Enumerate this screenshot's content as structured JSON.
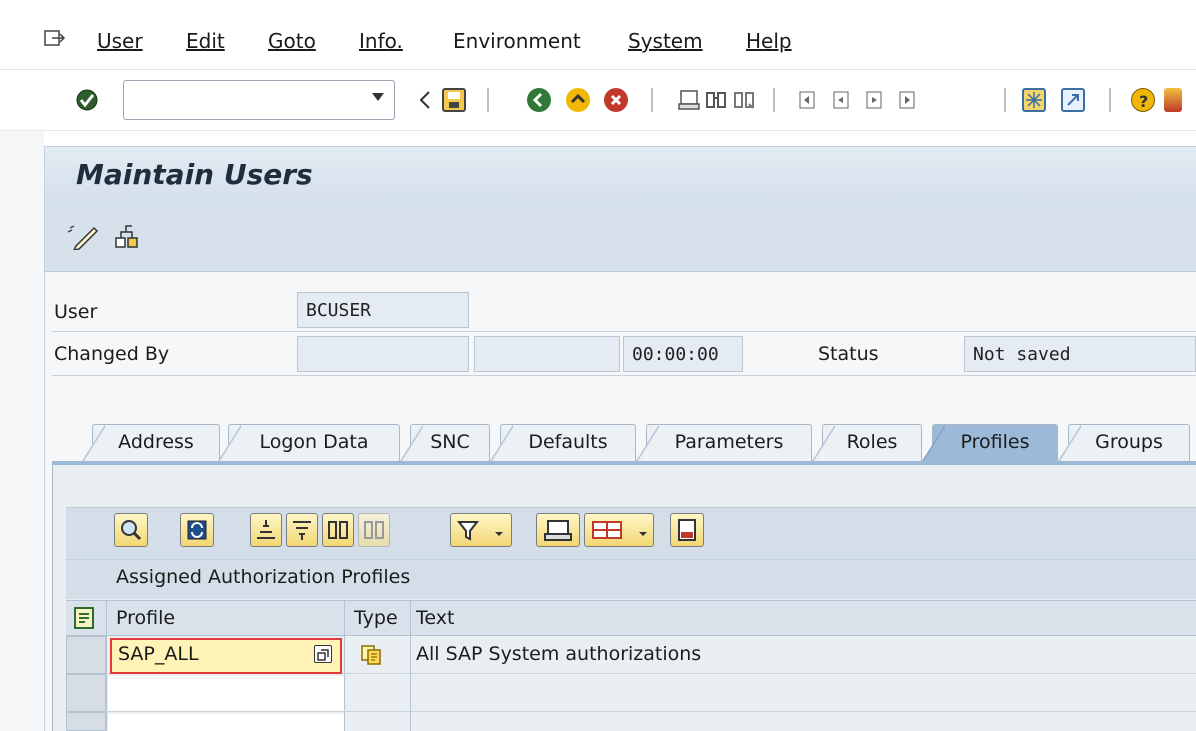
{
  "menubar": {
    "items": [
      {
        "label": "User"
      },
      {
        "label": "Edit"
      },
      {
        "label": "Goto"
      },
      {
        "label": "Info."
      },
      {
        "label": "Environment"
      },
      {
        "label": "System"
      },
      {
        "label": "Help"
      }
    ]
  },
  "toolbar": {
    "command_value": "",
    "icons": [
      "enter-icon",
      "back-arrow-icon",
      "save-icon",
      "back-icon",
      "exit-icon",
      "cancel-icon",
      "print-icon",
      "find-icon",
      "find-next-icon",
      "first-page-icon",
      "previous-page-icon",
      "next-page-icon",
      "last-page-icon",
      "new-session-icon",
      "shortcut-icon",
      "help-icon",
      "customize-layout-icon"
    ]
  },
  "title": "Maintain Users",
  "app_toolbar": {
    "icons": [
      "change-icon",
      "documentation-icon"
    ]
  },
  "form": {
    "user_label": "User",
    "user_value": "BCUSER",
    "changed_by_label": "Changed By",
    "changed_by_value": "",
    "changed_date_value": "",
    "changed_time_value": "00:00:00",
    "status_label": "Status",
    "status_value": "Not saved"
  },
  "tabs": [
    {
      "label": "Address",
      "active": false
    },
    {
      "label": "Logon Data",
      "active": false
    },
    {
      "label": "SNC",
      "active": false
    },
    {
      "label": "Defaults",
      "active": false
    },
    {
      "label": "Parameters",
      "active": false
    },
    {
      "label": "Roles",
      "active": false
    },
    {
      "label": "Profiles",
      "active": true
    },
    {
      "label": "Groups",
      "active": false
    }
  ],
  "table": {
    "toolbar_icons": [
      "details-icon",
      "refresh-icon",
      "sort-ascending-icon",
      "sort-descending-icon",
      "find-icon",
      "find-next-icon",
      "filter-icon",
      "print-icon",
      "layout-icon",
      "export-icon"
    ],
    "title": "Assigned Authorization Profiles",
    "columns": {
      "profile": "Profile",
      "type": "Type",
      "text": "Text"
    },
    "rows": [
      {
        "profile": "SAP_ALL",
        "type_icon": "composite-profile-icon",
        "text": "All SAP System authorizations"
      },
      {
        "profile": "",
        "text": ""
      },
      {
        "profile": "",
        "text": ""
      }
    ]
  },
  "colors": {
    "title_bar": "#d3dfeb",
    "active_tab": "#9cbad8",
    "selected_cell": "#fff3b8",
    "cell_border_error": "#e23b3b"
  }
}
